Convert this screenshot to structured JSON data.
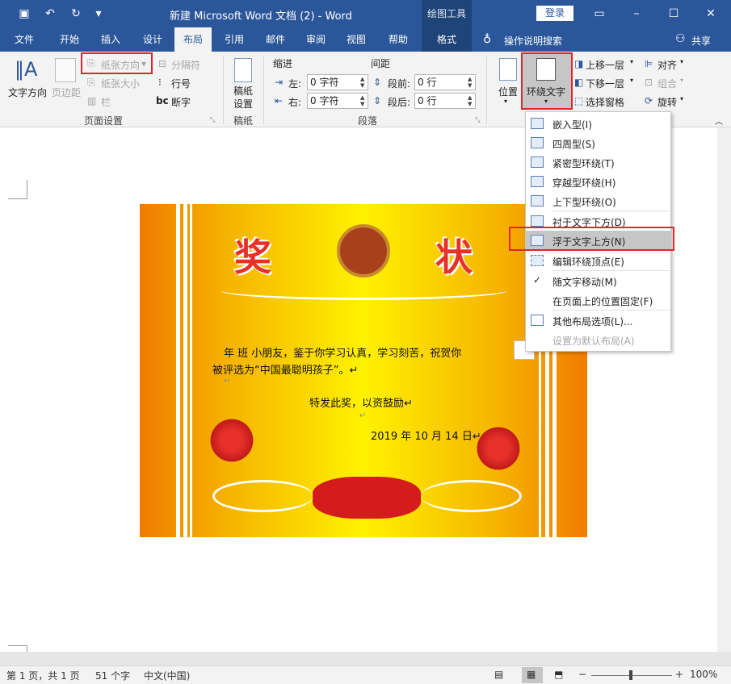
{
  "titlebar": {
    "title": "新建 Microsoft Word 文档 (2)  -  Word",
    "context_tab_label": "绘图工具",
    "login": "登录",
    "qat": {
      "save_icon": "save-icon",
      "undo_icon": "undo-icon",
      "redo_icon": "redo-icon",
      "customize_icon": "customize-icon"
    }
  },
  "tabs": [
    {
      "label": "文件"
    },
    {
      "label": "开始"
    },
    {
      "label": "插入"
    },
    {
      "label": "设计"
    },
    {
      "label": "布局"
    },
    {
      "label": "引用"
    },
    {
      "label": "邮件"
    },
    {
      "label": "审阅"
    },
    {
      "label": "视图"
    },
    {
      "label": "帮助"
    },
    {
      "label": "格式"
    }
  ],
  "tell_me": "操作说明搜索",
  "share": "共享",
  "ribbon": {
    "text_direction": "文字方向",
    "margins": "页边距",
    "orientation": "纸张方向",
    "size": "纸张大小",
    "columns": "栏",
    "breaks": "分隔符",
    "line_numbers": "行号",
    "hyphenation": "断字",
    "page_setup_group": "页面设置",
    "draft_paper": "稿纸\n设置",
    "draft_paper_group": "稿纸",
    "indent_label": "缩进",
    "spacing_label": "间距",
    "left_label": "左:",
    "right_label": "右:",
    "before_label": "段前:",
    "after_label": "段后:",
    "indent_left": "0 字符",
    "indent_right": "0 字符",
    "space_before": "0 行",
    "space_after": "0 行",
    "paragraph_group": "段落",
    "position": "位置",
    "wrap_text": "环绕文字",
    "bring_forward": "上移一层",
    "send_backward": "下移一层",
    "selection_pane": "选择窗格",
    "align": "对齐",
    "group": "组合",
    "rotate": "旋转"
  },
  "wrap_menu": [
    {
      "label": "嵌入型(I)",
      "icon": "inline-wrap-icon"
    },
    {
      "label": "四周型(S)",
      "icon": "square-wrap-icon"
    },
    {
      "label": "紧密型环绕(T)",
      "icon": "tight-wrap-icon"
    },
    {
      "label": "穿越型环绕(H)",
      "icon": "through-wrap-icon"
    },
    {
      "label": "上下型环绕(O)",
      "icon": "top-bottom-wrap-icon"
    },
    {
      "label": "衬于文字下方(D)",
      "icon": "behind-text-icon"
    },
    {
      "label": "浮于文字上方(N)",
      "icon": "in-front-text-icon"
    },
    {
      "label": "编辑环绕顶点(E)",
      "icon": "edit-wrap-points-icon"
    },
    {
      "label": "随文字移动(M)",
      "icon": "check-icon"
    },
    {
      "label": "在页面上的位置固定(F)",
      "icon": ""
    },
    {
      "label": "其他布局选项(L)...",
      "icon": "layout-options-icon"
    },
    {
      "label": "设置为默认布局(A)",
      "icon": ""
    }
  ],
  "certificate": {
    "title_left": "奖",
    "title_right": "状",
    "line1": "年   班   小朋友，鉴于你学习认真，学习刻苦，祝贺你",
    "line2": "被评选为“中国最聪明孩子”。↵",
    "line3": "↵",
    "line4": "特发此奖，以资鼓励↵",
    "line5": "↵",
    "line6": "2019 年 10 月 14 日↵"
  },
  "status": {
    "page": "第 1 页，共 1 页",
    "words": "51 个字",
    "lang": "中文(中国)",
    "zoom": "100%"
  }
}
